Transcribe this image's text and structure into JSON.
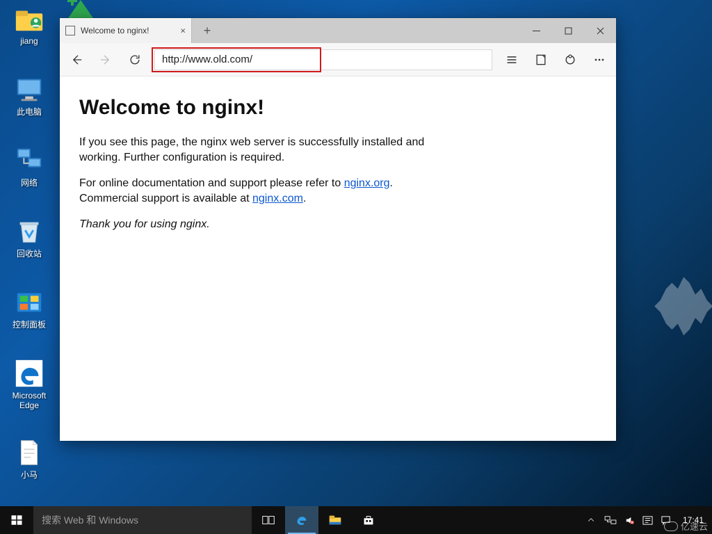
{
  "desktop": {
    "icons": [
      {
        "name": "user-folder-icon",
        "label": "jiang"
      },
      {
        "name": "computer-icon",
        "label": "此电脑"
      },
      {
        "name": "network-icon",
        "label": "网络"
      },
      {
        "name": "recycle-bin-icon",
        "label": "回收站"
      },
      {
        "name": "control-panel-icon",
        "label": "控制面板"
      },
      {
        "name": "edge-icon",
        "label": "Microsoft Edge"
      },
      {
        "name": "notepad-file-icon",
        "label": "小马"
      }
    ]
  },
  "browser": {
    "tab_title": "Welcome to nginx!",
    "address": "http://www.old.com/",
    "page": {
      "heading": "Welcome to nginx!",
      "para1": "If you see this page, the nginx web server is successfully installed and working. Further configuration is required.",
      "para2a": "For online documentation and support please refer to ",
      "link1_text": "nginx.org",
      "para2b": ".",
      "para3a": "Commercial support is available at ",
      "link2_text": "nginx.com",
      "para3b": ".",
      "thanks": "Thank you for using nginx."
    },
    "controls": {
      "close_tab": "×",
      "new_tab": "+"
    }
  },
  "taskbar": {
    "search_placeholder": "搜索 Web 和 Windows",
    "clock_time": "17:41",
    "clock_date": ""
  },
  "watermark": {
    "text": "亿速云"
  }
}
